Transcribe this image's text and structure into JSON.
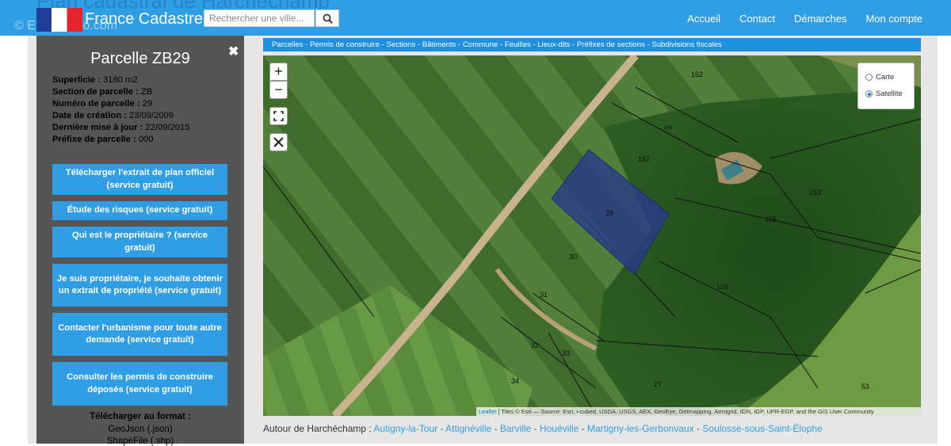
{
  "header": {
    "page_title_ghost": "Plan cadastral de Harchéchamp",
    "watermark": "© Etreproprio.com",
    "brand": "France Cadastre",
    "search_placeholder": "Rechercher une ville...",
    "nav": [
      "Accueil",
      "Contact",
      "Démarches",
      "Mon compte"
    ]
  },
  "sidebar": {
    "title": "Parcelle ZB29",
    "close_icon": "close-icon",
    "info": [
      {
        "label": "Superficie :",
        "value": "3180 m2"
      },
      {
        "label": "Section de parcelle :",
        "value": "ZB"
      },
      {
        "label": "Numéro de parcelle :",
        "value": "29"
      },
      {
        "label": "Date de création :",
        "value": "23/09/2009"
      },
      {
        "label": "Dernière mise à jour :",
        "value": "22/09/2015"
      },
      {
        "label": "Préfixe de parcelle :",
        "value": "000"
      }
    ],
    "buttons": [
      "Télécharger l'extrait de plan officiel (service gratuit)",
      "Étude des risques (service gratuit)",
      "Qui est le propriétaire ? (service gratuit)",
      "Je suis propriétaire, je souhaite obtenir un extrait de propriété (service gratuit)",
      "Contacter l'urbanisme pour toute autre demande (service gratuit)",
      "Consulter les permis de construire déposés (service gratuit)"
    ],
    "download_title": "Télécharger au format :",
    "download_formats": [
      "GeoJson (.json)",
      "ShapeFile (.shp)"
    ]
  },
  "layers_bar": "Parcelles - Permis de construire - Sections - Bâtiments - Commune - Feuilles - Lieux-dits - Préfixes de sections - Subdivisions fiscales",
  "map": {
    "zoom_in": "+",
    "zoom_out": "−",
    "fullscreen_icon": "fullscreen-icon",
    "measure_icon": "ruler-icon",
    "basemap_options": [
      "Carte",
      "Satellite"
    ],
    "basemap_selected": "Satellite",
    "parcel_labels": [
      "152",
      "154",
      "157",
      "153",
      "29",
      "155",
      "30",
      "156",
      "31",
      "32",
      "33",
      "34",
      "27",
      "53"
    ],
    "attribution_link": "Leaflet",
    "attribution_text": "| Tiles © Esri — Source: Esri, i-cubed, USDA, USGS, AEX, GeoEye, Getmapping, Aerogrid, IGN, IGP, UPR-EGP, and the GIS User Community"
  },
  "around": {
    "prefix": "Autour de Harchéchamp :",
    "towns": [
      "Autigny-la-Tour",
      "Attignéville",
      "Barville",
      "Houéville",
      "Martigny-les-Gerbonvaux",
      "Soulosse-sous-Saint-Élophe"
    ]
  },
  "colors": {
    "accent": "#2f9ee4",
    "sidebar": "#555555",
    "selected_parcel": "#2a3a8c"
  }
}
